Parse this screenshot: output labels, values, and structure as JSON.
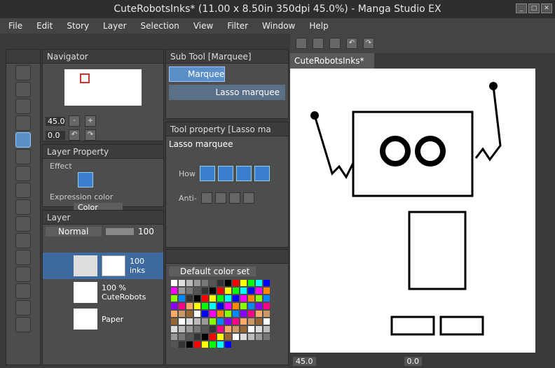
{
  "window": {
    "title": "CuteRobotsInks* (11.00 x 8.50in 350dpi 45.0%)  - Manga Studio EX"
  },
  "menu": [
    "File",
    "Edit",
    "Story",
    "Layer",
    "Selection",
    "View",
    "Filter",
    "Window",
    "Help"
  ],
  "navigator": {
    "title": "Navigator",
    "zoom": "45.0",
    "rotation": "0.0"
  },
  "layer_property": {
    "title": "Layer Property",
    "effect_label": "Effect",
    "expression_label": "Expression color",
    "color_value": "Color"
  },
  "layer_panel": {
    "title": "Layer",
    "blend_mode": "Normal",
    "opacity": "100",
    "layers": [
      {
        "name": "inks",
        "opacity": "100"
      },
      {
        "name": "CuteRobots",
        "opacity": "100 %"
      },
      {
        "name": "Paper"
      }
    ]
  },
  "subtool": {
    "title": "Sub Tool [Marquee]",
    "group": "Marquee",
    "selected": "Lasso marquee"
  },
  "toolprop": {
    "title": "Tool property [Lasso ma",
    "name": "Lasso marquee",
    "how_label": "How",
    "anti_label": "Anti-"
  },
  "color_set": {
    "selected": "Default color set"
  },
  "canvas": {
    "tab": "CuteRobotsInks*",
    "zoom": "45.0",
    "rotation": "0.0"
  }
}
